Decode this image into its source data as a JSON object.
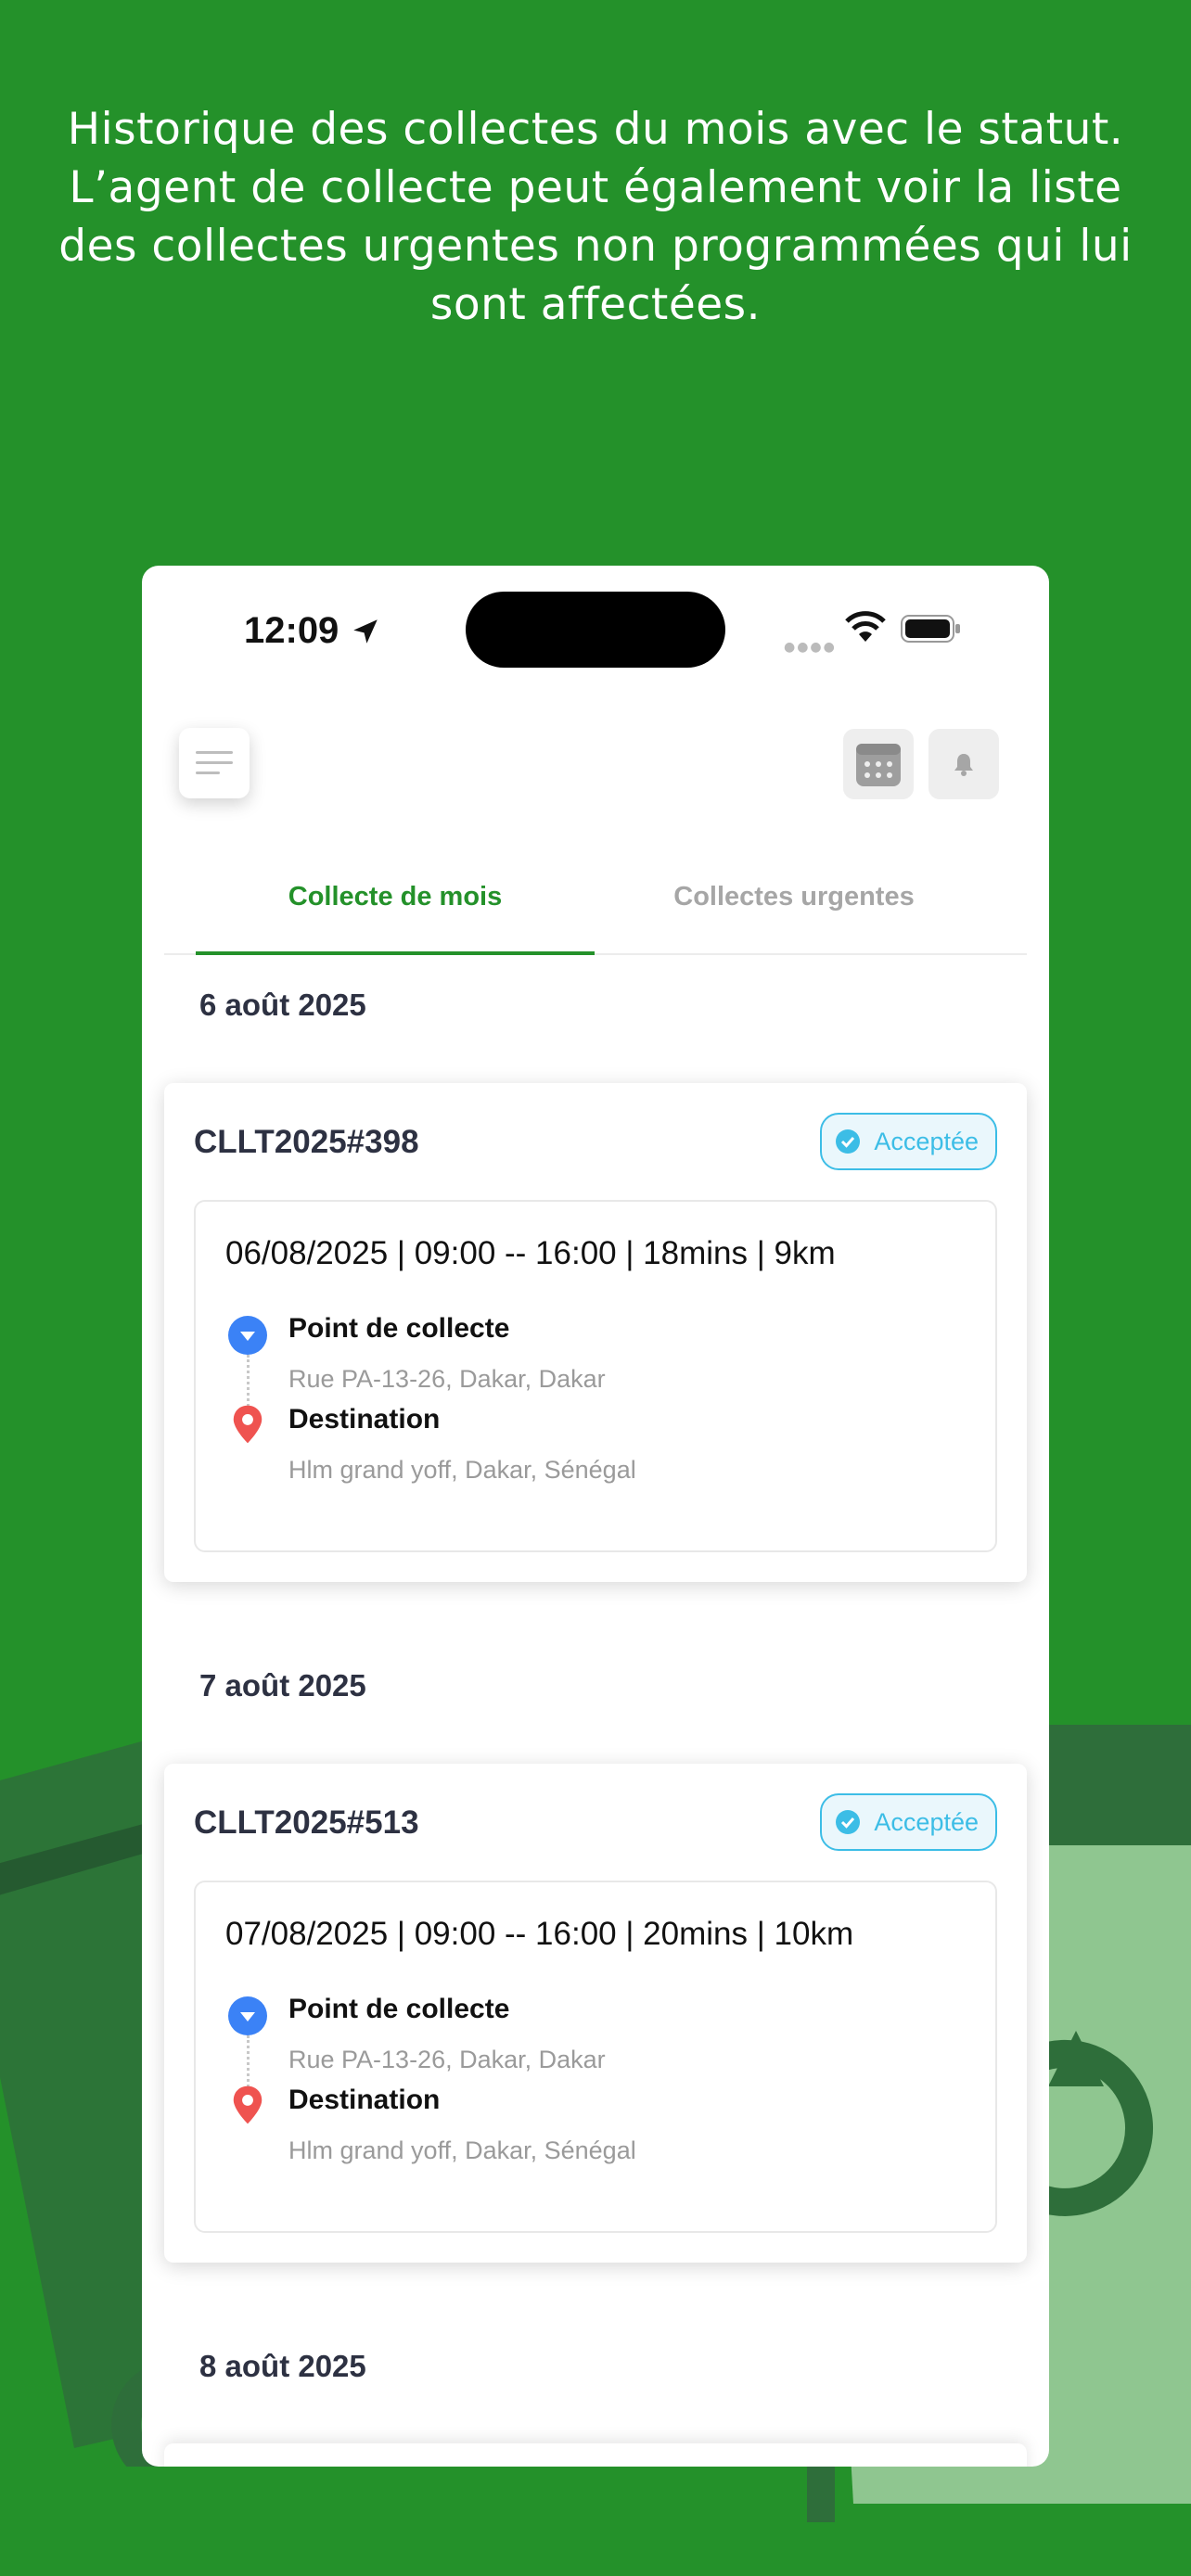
{
  "caption": "Historique des collectes du mois avec le statut. L’agent de collecte peut également voir la liste des collectes urgentes non programmées qui lui sont affectées.",
  "status_bar": {
    "time": "12:09"
  },
  "tabs": [
    {
      "label": "Collecte de mois",
      "active": true
    },
    {
      "label": "Collectes urgentes",
      "active": false
    }
  ],
  "groups": [
    {
      "date": "6 août 2025",
      "id": "CLLT2025#398",
      "status": "Acceptée",
      "info": "06/08/2025 | 09:00 -- 16:00 | 18mins | 9km",
      "pickup_label": "Point de collecte",
      "pickup_address": "Rue PA-13-26, Dakar, Dakar",
      "dest_label": "Destination",
      "dest_address": "Hlm grand yoff, Dakar, Sénégal"
    },
    {
      "date": "7 août 2025",
      "id": "CLLT2025#513",
      "status": "Acceptée",
      "info": "07/08/2025 | 09:00 -- 16:00 | 20mins | 10km",
      "pickup_label": "Point de collecte",
      "pickup_address": "Rue PA-13-26, Dakar, Dakar",
      "dest_label": "Destination",
      "dest_address": "Hlm grand yoff, Dakar, Sénégal"
    },
    {
      "date": "8 août 2025"
    }
  ],
  "colors": {
    "brand_green": "#24912a",
    "badge_blue": "#3cbde6",
    "pickup_pin": "#3b82f6",
    "destination_pin": "#ef5350"
  },
  "icons": [
    "location-arrow-icon",
    "wifi-icon",
    "battery-icon",
    "menu-icon",
    "calendar-icon",
    "bell-icon",
    "check-circle-icon",
    "pickup-pin-icon",
    "destination-pin-icon"
  ]
}
